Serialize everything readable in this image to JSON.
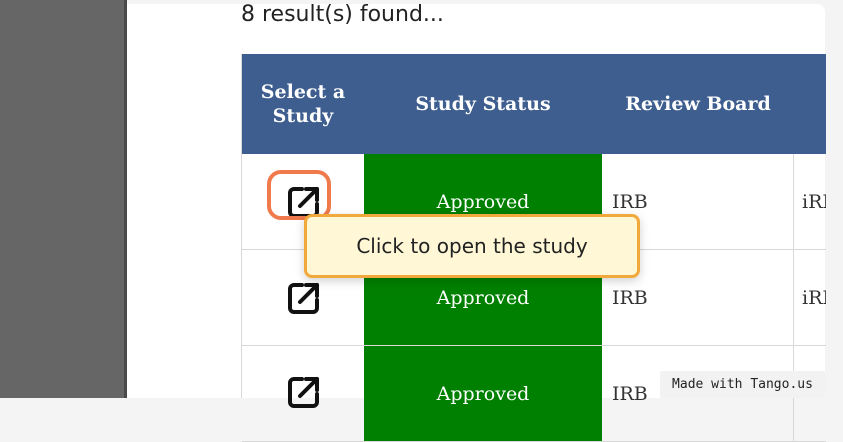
{
  "results": {
    "text": "8 result(s) found..."
  },
  "table": {
    "headers": {
      "select": "Select a Study",
      "status": "Study Status",
      "board": "Review Board"
    },
    "rows": [
      {
        "status": "Approved",
        "board": "IRB",
        "next": "iRI"
      },
      {
        "status": "Approved",
        "board": "IRB",
        "next": "iRI"
      },
      {
        "status": "Approved",
        "board": "IRB",
        "next": ""
      }
    ]
  },
  "tooltip": {
    "text": "Click to open the study"
  },
  "watermark": {
    "text": "Made with Tango.us"
  },
  "colors": {
    "header_bg": "#3e5e8f",
    "status_approved": "#008000",
    "highlight": "#f07a4b",
    "tooltip_border": "#f2a93b",
    "tooltip_bg": "#fff7d6"
  },
  "icons": {
    "open": "open-external-icon"
  }
}
